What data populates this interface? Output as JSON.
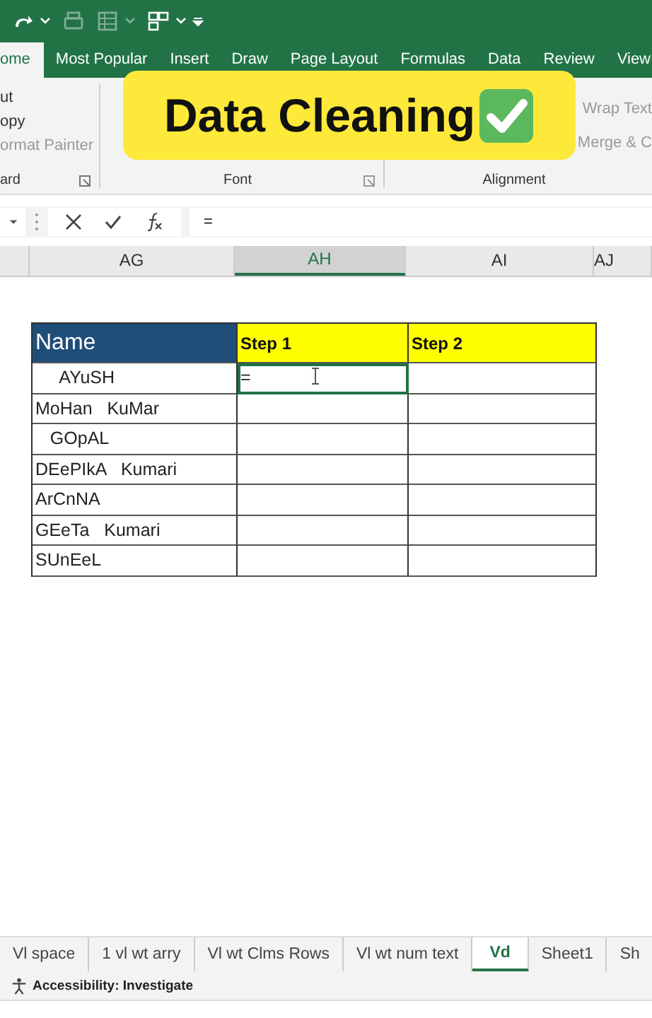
{
  "ribbon_tabs": [
    {
      "label": "ome",
      "selected": true
    },
    {
      "label": "Most Popular",
      "selected": false
    },
    {
      "label": "Insert",
      "selected": false
    },
    {
      "label": "Draw",
      "selected": false
    },
    {
      "label": "Page Layout",
      "selected": false
    },
    {
      "label": "Formulas",
      "selected": false
    },
    {
      "label": "Data",
      "selected": false
    },
    {
      "label": "Review",
      "selected": false
    },
    {
      "label": "View",
      "selected": false
    }
  ],
  "clipboard": {
    "items": [
      "ut",
      "opy",
      "ormat Painter"
    ],
    "group": "ard"
  },
  "font_group": {
    "group": "Font"
  },
  "alignment": {
    "items": [
      "Wrap Text",
      "Merge & C"
    ],
    "group": "Alignment"
  },
  "banner": {
    "text": "Data Cleaning"
  },
  "formula_bar": {
    "value": "="
  },
  "columns": [
    {
      "label": "AG",
      "selected": false
    },
    {
      "label": "AH",
      "selected": true
    },
    {
      "label": "AI",
      "selected": false
    },
    {
      "label": "AJ",
      "selected": false
    }
  ],
  "table": {
    "headers": [
      "Name",
      "Step 1",
      "Step 2"
    ],
    "rows": [
      {
        "name": "     AYuSH",
        "step_1": "=",
        "selected": true
      },
      {
        "name": "MoHan   KuMar",
        "selected": false
      },
      {
        "name": "   GOpAL",
        "selected": false
      },
      {
        "name": "DEePIkA   Kumari",
        "selected": false
      },
      {
        "name": "ArCnNA",
        "selected": false
      },
      {
        "name": "GEeTa   Kumari",
        "selected": false
      },
      {
        "name": "SUnEeL",
        "selected": false
      }
    ]
  },
  "sheet_tabs": [
    {
      "label": "Vl space",
      "selected": false
    },
    {
      "label": "1 vl wt arry",
      "selected": false
    },
    {
      "label": "Vl wt Clms Rows",
      "selected": false
    },
    {
      "label": "Vl wt num text",
      "selected": false
    },
    {
      "label": "Vd",
      "selected": true
    },
    {
      "label": "Sheet1",
      "selected": false
    },
    {
      "label": "Sh",
      "selected": false
    }
  ],
  "status_bar": {
    "text": "Accessibility: Investigate"
  }
}
